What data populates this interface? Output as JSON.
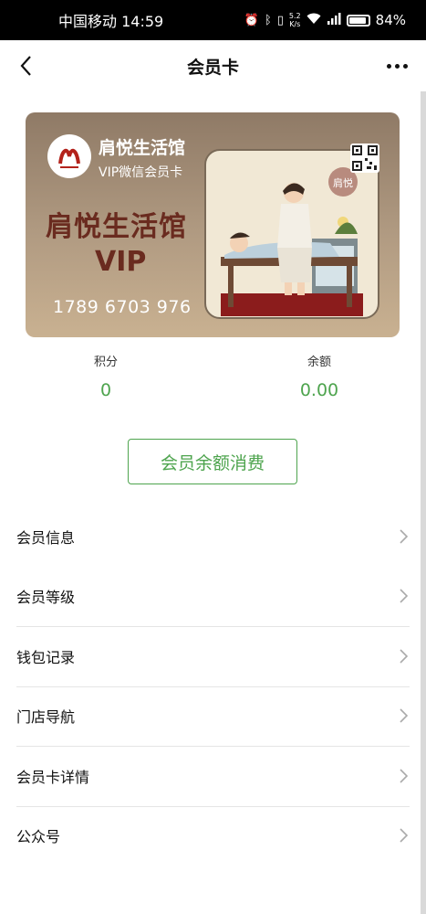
{
  "status_bar": {
    "carrier_time": "中国移动 14:59",
    "net_speed_value": "5.2",
    "net_speed_unit": "K/s",
    "battery": "84%",
    "icons": [
      "alarm-icon",
      "bluetooth-icon",
      "vibrate-icon",
      "wifi-icon",
      "signal-icon",
      "battery-icon"
    ]
  },
  "nav": {
    "title": "会员卡",
    "back_icon": "chevron-left-icon",
    "more_icon": "more-dots-icon"
  },
  "card": {
    "brand": "肩悦生活馆",
    "subtitle": "VIP微信会员卡",
    "big_name": "肩悦生活馆",
    "vip": "VIP",
    "number": "1789 6703 976",
    "badge_text": "肩悦",
    "colors": {
      "title_brown": "#6a2b1f",
      "card_top": "#8f7a66",
      "card_bottom": "#c9b191"
    }
  },
  "stats": {
    "points_label": "积分",
    "points_value": "0",
    "balance_label": "余额",
    "balance_value": "0.00"
  },
  "consume_button": "会员余额消费",
  "menu": [
    {
      "label": "会员信息"
    },
    {
      "label": "会员等级"
    },
    {
      "label": "钱包记录"
    },
    {
      "label": "门店导航"
    },
    {
      "label": "会员卡详情"
    },
    {
      "label": "公众号"
    }
  ],
  "accent_color": "#4ea44e"
}
